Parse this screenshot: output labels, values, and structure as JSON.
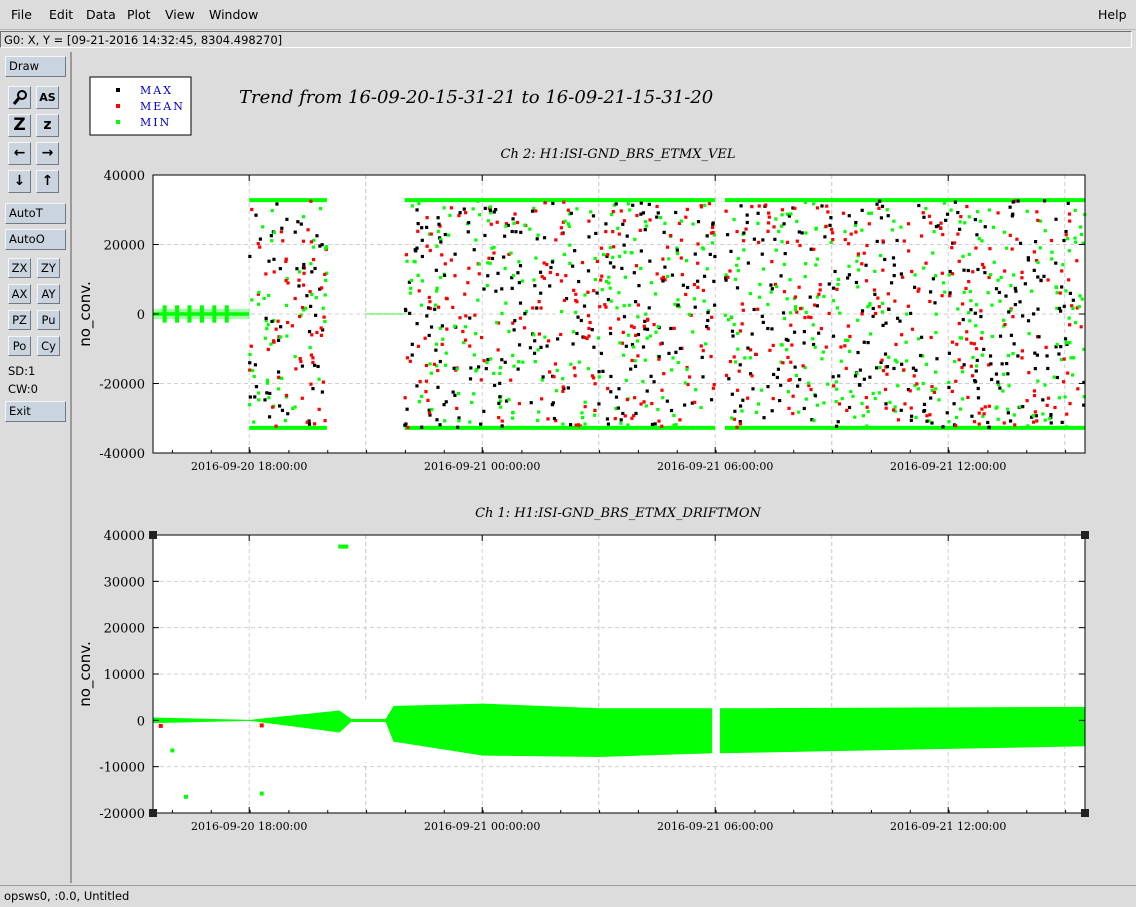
{
  "menu": {
    "items": [
      "File",
      "Edit",
      "Data",
      "Plot",
      "View",
      "Window"
    ],
    "help": "Help"
  },
  "readout": "G0: X, Y = [09-21-2016 14:32:45, 8304.498270]",
  "toolbar": {
    "draw": "Draw",
    "zoom_tool": "✖",
    "as_label": "AS",
    "zoom_in": "Z",
    "zoom_out": "z",
    "left": "←",
    "right": "→",
    "down": "↓",
    "up": "↑",
    "autot": "AutoT",
    "autoo": "AutoO",
    "zx": "ZX",
    "zy": "ZY",
    "ax": "AX",
    "ay": "AY",
    "pz": "PZ",
    "pu": "Pu",
    "po": "Po",
    "cy": "Cy",
    "sd": "SD:1",
    "cw": "CW:0",
    "exit": "Exit"
  },
  "status": "opsws0, :0.0, Untitled",
  "chart_data": [
    {
      "type": "scatter",
      "title": "Trend from 16-09-20-15-31-21 to 16-09-21-15-31-20",
      "subtitle": "Ch 2: H1:ISI-GND_BRS_ETMX_VEL",
      "ylabel": "no_conv.",
      "xlabel": "",
      "ylim": [
        -40000,
        40000
      ],
      "yticks": [
        -40000,
        -20000,
        0,
        20000,
        40000
      ],
      "xticks": [
        "2016-09-20 18:00:00",
        "2016-09-21 00:00:00",
        "2016-09-21 06:00:00",
        "2016-09-21 12:00:00"
      ],
      "xrange": [
        "2016-09-20 15:31:21",
        "2016-09-21 15:31:20"
      ],
      "grid": true,
      "legend_position": "top-left",
      "series": [
        {
          "name": "MAX",
          "color": "#000000"
        },
        {
          "name": "MEAN",
          "color": "#ff0000"
        },
        {
          "name": "MIN",
          "color": "#00ff00"
        }
      ],
      "segments": [
        {
          "start": "2016-09-20 15:31:21",
          "end": "2016-09-20 18:00:00",
          "y_center": 0,
          "amplitude": 1500
        },
        {
          "start": "2016-09-20 18:00:00",
          "end": "2016-09-20 20:00:00",
          "y_center": 0,
          "amplitude": 32767
        },
        {
          "start": "2016-09-20 21:00:00",
          "end": "2016-09-20 22:00:00",
          "y_center": 0,
          "amplitude": 200
        },
        {
          "start": "2016-09-20 22:00:00",
          "end": "2016-09-21 05:30:00",
          "y_center": 0,
          "amplitude": 32767
        },
        {
          "start": "2016-09-21 05:30:00",
          "end": "2016-09-21 06:00:00",
          "y_center": 0,
          "amplitude": 32767
        },
        {
          "start": "2016-09-21 06:15:00",
          "end": "2016-09-21 15:31:20",
          "y_center": 0,
          "amplitude": 32767
        }
      ]
    },
    {
      "type": "area",
      "subtitle": "Ch 1: H1:ISI-GND_BRS_ETMX_DRIFTMON",
      "ylabel": "no_conv.",
      "xlabel": "",
      "ylim": [
        -20000,
        40000
      ],
      "yticks": [
        -20000,
        -10000,
        0,
        10000,
        20000,
        30000,
        40000
      ],
      "xticks": [
        "2016-09-20 18:00:00",
        "2016-09-21 00:00:00",
        "2016-09-21 06:00:00",
        "2016-09-21 12:00:00"
      ],
      "grid": true,
      "series": [
        {
          "name": "MIN",
          "color": "#00ff00"
        }
      ],
      "envelope": [
        {
          "t_hours": 0.0,
          "hi": 500,
          "lo": -500
        },
        {
          "t_hours": 2.5,
          "hi": 0,
          "lo": 0
        },
        {
          "t_hours": 4.8,
          "hi": 2000,
          "lo": -2500
        },
        {
          "t_hours": 5.1,
          "hi": 200,
          "lo": -200
        },
        {
          "t_hours": 6.0,
          "hi": 200,
          "lo": -200
        },
        {
          "t_hours": 6.2,
          "hi": 3000,
          "lo": -4500
        },
        {
          "t_hours": 8.5,
          "hi": 3500,
          "lo": -7500
        },
        {
          "t_hours": 11.5,
          "hi": 2500,
          "lo": -7800
        },
        {
          "t_hours": 14.4,
          "hi": 2500,
          "lo": -7000
        },
        {
          "t_hours": 14.6,
          "hi": 2500,
          "lo": -7000
        },
        {
          "t_hours": 24.0,
          "hi": 2800,
          "lo": -5500
        }
      ],
      "outliers": [
        {
          "t_hours": 4.9,
          "y": 37500
        },
        {
          "t_hours": 0.5,
          "y": -6500
        },
        {
          "t_hours": 0.85,
          "y": -16500
        },
        {
          "t_hours": 2.8,
          "y": -15800
        },
        {
          "t_hours": 0.2,
          "y": -1200
        },
        {
          "t_hours": 2.8,
          "y": -1100
        }
      ]
    }
  ]
}
